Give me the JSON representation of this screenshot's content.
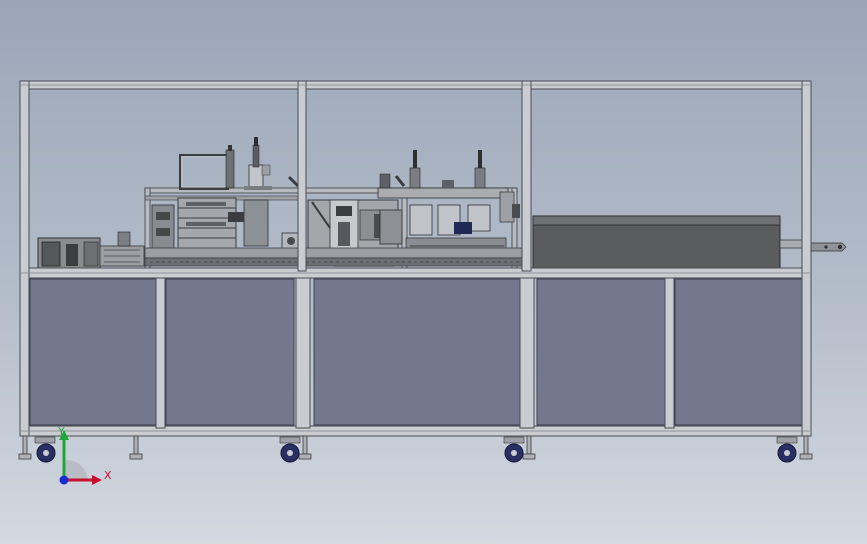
{
  "viewport": {
    "background_top": "#9aa6b8",
    "background_bottom": "#d4d9e0"
  },
  "machine": {
    "frame_color": "#c9ccd1",
    "frame_edge_color": "#4a4d52",
    "panel_color": "#75778f",
    "panel_count": 5,
    "upper_bays": 3,
    "hood_color": "#5b5c5e",
    "caster_wheel_color": "#2a2f63",
    "leveling_feet": 7,
    "caster_wheels": 4
  },
  "triad": {
    "x_label": "X",
    "y_label": "Y",
    "z_label": "",
    "x_color": "#c8102e",
    "y_color": "#1fa83a",
    "z_color": "#1a2bd0"
  }
}
